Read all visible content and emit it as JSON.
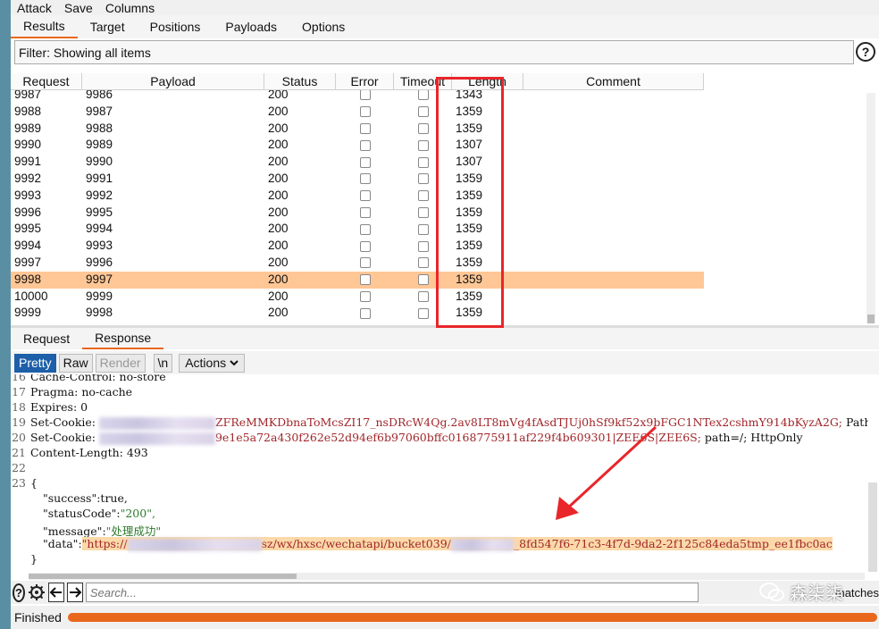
{
  "menu": [
    "Attack",
    "Save",
    "Columns"
  ],
  "tabs": [
    "Results",
    "Target",
    "Positions",
    "Payloads",
    "Options"
  ],
  "filter_text": "Filter: Showing all items",
  "help_label": "?",
  "columns": [
    "Request",
    "Payload",
    "Status",
    "Error",
    "Timeout",
    "Length",
    "Comment"
  ],
  "rows": [
    {
      "request": "9987",
      "payload": "9986",
      "status": "200",
      "length": "1343"
    },
    {
      "request": "9988",
      "payload": "9987",
      "status": "200",
      "length": "1359"
    },
    {
      "request": "9989",
      "payload": "9988",
      "status": "200",
      "length": "1359"
    },
    {
      "request": "9990",
      "payload": "9989",
      "status": "200",
      "length": "1307"
    },
    {
      "request": "9991",
      "payload": "9990",
      "status": "200",
      "length": "1307"
    },
    {
      "request": "9992",
      "payload": "9991",
      "status": "200",
      "length": "1359"
    },
    {
      "request": "9993",
      "payload": "9992",
      "status": "200",
      "length": "1359"
    },
    {
      "request": "9996",
      "payload": "9995",
      "status": "200",
      "length": "1359"
    },
    {
      "request": "9995",
      "payload": "9994",
      "status": "200",
      "length": "1359"
    },
    {
      "request": "9994",
      "payload": "9993",
      "status": "200",
      "length": "1359"
    },
    {
      "request": "9997",
      "payload": "9996",
      "status": "200",
      "length": "1359"
    },
    {
      "request": "9998",
      "payload": "9997",
      "status": "200",
      "length": "1359",
      "selected": true
    },
    {
      "request": "10000",
      "payload": "9999",
      "status": "200",
      "length": "1359"
    },
    {
      "request": "9999",
      "payload": "9998",
      "status": "200",
      "length": "1359"
    }
  ],
  "subtabs": [
    "Request",
    "Response"
  ],
  "toolbar": {
    "pretty": "Pretty",
    "raw": "Raw",
    "render": "Render",
    "newline": "\\n",
    "actions": "Actions"
  },
  "code_lines": [
    {
      "n": "16",
      "text": "Cache-Control: no-store"
    },
    {
      "n": "17",
      "text": "Pragma: no-cache"
    },
    {
      "n": "18",
      "text": "Expires: 0"
    },
    {
      "n": "19",
      "key": "Set-Cookie: ",
      "val": "ZFReMMKDbnaToMcsZI17_nsDRcW4Qg.2av8LT8mVg4fAsdTJUj0hSf9kf52x9bFGC1NTex2cshmY914bKyzA2G;",
      "rest": " Path=/; expires="
    },
    {
      "n": "20",
      "key": "Set-Cookie: ",
      "val": "9e1e5a72a430f262e52d94ef6b97060bffc0168775911af229f4b609301|ZEE6S|ZEE6S;",
      "rest": " path=/; HttpOnly"
    },
    {
      "n": "21",
      "text": "Content-Length: 493"
    },
    {
      "n": "22",
      "text": ""
    },
    {
      "n": "23",
      "text": "{"
    },
    {
      "n": "",
      "key": "\"success\"",
      "rest": ":true,"
    },
    {
      "n": "",
      "key": "\"statusCode\"",
      "rest": ":",
      "val": "\"200\","
    },
    {
      "n": "",
      "key": "\"message\"",
      "rest": ":",
      "val": "\"处理成功\""
    },
    {
      "n": "",
      "key": "\"data\"",
      "rest": ":",
      "url_a": "\"https://",
      "url_b": "sz/wx/hxsc/wechatapi/bucket039/",
      "url_c": "_8fd547f6-71c3-4f7d-9da2-2f125c84eda5tmp_ee1fbc0ac"
    },
    {
      "n": "",
      "text": "}"
    }
  ],
  "search_placeholder": "Search...",
  "matches_label": "matches",
  "watermark": "森柒柒",
  "status_text": "Finished",
  "progress": 1.0,
  "colors": {
    "accent": "#e8671c",
    "selected_row": "#ffc796",
    "highlight_box": "#e8262a",
    "pretty_active": "#1d5fa8"
  }
}
